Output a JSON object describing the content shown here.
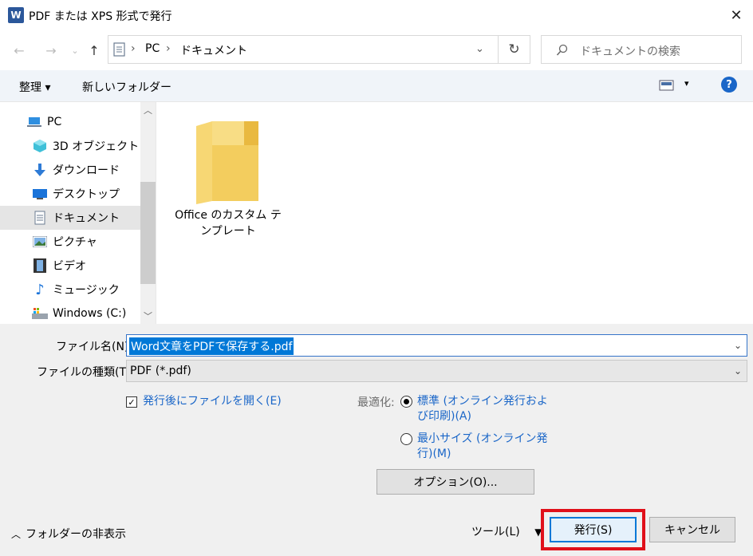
{
  "window": {
    "app_icon_letter": "W",
    "title": "PDF または XPS 形式で発行",
    "close_glyph": "✕"
  },
  "address": {
    "breadcrumb": [
      "PC",
      "ドキュメント"
    ],
    "search_placeholder": "ドキュメントの検索"
  },
  "toolbar": {
    "organize_label": "整理 ▾",
    "new_folder_label": "新しいフォルダー",
    "help_label": "?"
  },
  "nav_pane": {
    "items": [
      {
        "label": "PC",
        "icon": "pc-icon"
      },
      {
        "label": "3D オブジェクト",
        "icon": "3d-objects-icon"
      },
      {
        "label": "ダウンロード",
        "icon": "download-icon"
      },
      {
        "label": "デスクトップ",
        "icon": "desktop-icon"
      },
      {
        "label": "ドキュメント",
        "icon": "documents-icon",
        "selected": true
      },
      {
        "label": "ピクチャ",
        "icon": "pictures-icon"
      },
      {
        "label": "ビデオ",
        "icon": "video-icon"
      },
      {
        "label": "ミュージック",
        "icon": "music-icon"
      },
      {
        "label": "Windows (C:)",
        "icon": "drive-icon"
      }
    ]
  },
  "files": [
    {
      "name": "Office のカスタム テンプレート",
      "icon": "folder-icon"
    }
  ],
  "form": {
    "filename_label": "ファイル名(N):",
    "filename_value": "Word文章をPDFで保存する.pdf",
    "filetype_label": "ファイルの種類(T):",
    "filetype_value": "PDF (*.pdf)",
    "open_after_label": "発行後にファイルを開く(E)",
    "open_after_checked": true,
    "optimize_label": "最適化:",
    "optimize_standard_line1": "標準 (オンライン発行およ",
    "optimize_standard_line2": "び印刷)(A)",
    "optimize_standard_selected": true,
    "optimize_min_line1": "最小サイズ (オンライン発",
    "optimize_min_line2": "行)(M)",
    "options_button": "オプション(O)..."
  },
  "footer": {
    "hide_folders_label": "フォルダーの非表示",
    "tools_label": "ツール(L)",
    "publish_button": "発行(S)",
    "cancel_button": "キャンセル"
  },
  "colors": {
    "accent": "#0078d7",
    "highlight": "#e0101a",
    "link_text": "#1a66c8"
  }
}
